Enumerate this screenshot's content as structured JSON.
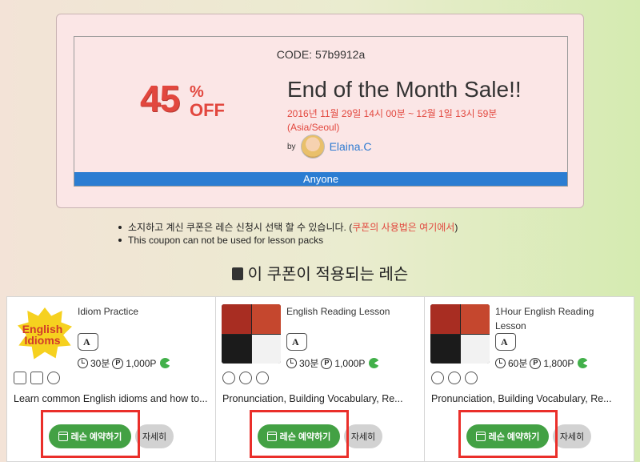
{
  "coupon": {
    "code_label": "CODE: 57b9912a",
    "discount_number": "45",
    "discount_percent": "%",
    "discount_off": "OFF",
    "title": "End of the Month Sale!!",
    "period": "2016년 11월 29일 14시 00분 ~ 12월 1일 13시 59분 (Asia/Seoul)",
    "by_label": "by",
    "author": "Elaina.C",
    "audience": "Anyone"
  },
  "notes": {
    "note1_text": "소지하고 계신 쿠폰은 레슨 신청시 선택 할 수 있습니다. (",
    "note1_link": "쿠폰의 사용법은 여기에서",
    "note1_close": ")",
    "note2": "This coupon can not be used for lesson packs"
  },
  "section_title": "이 쿠폰이 적용되는 레슨",
  "lessons": [
    {
      "title": "Idiom Practice",
      "thumb_text_line1": "English",
      "thumb_text_line2": "Idioms",
      "duration": "30분",
      "price": "1,000P",
      "description": "Learn common English idioms and how to...",
      "book_label": "레슨 예약하기",
      "detail_label": "자세히"
    },
    {
      "title": "English Reading Lesson",
      "duration": "30분",
      "price": "1,000P",
      "description": "Pronunciation, Building Vocabulary, Re...",
      "book_label": "레슨 예약하기",
      "detail_label": "자세히"
    },
    {
      "title": "1Hour English Reading Lesson",
      "duration": "60분",
      "price": "1,800P",
      "description": "Pronunciation, Building Vocabulary, Re...",
      "book_label": "레슨 예약하기",
      "detail_label": "자세히"
    }
  ],
  "point_symbol": "P",
  "colors": {
    "accent_red": "#e2473e",
    "link_blue": "#2f7bd1",
    "audience_bar": "#2b7dd2",
    "book_button": "#43a144",
    "highlight_box": "#ea2f2a"
  }
}
